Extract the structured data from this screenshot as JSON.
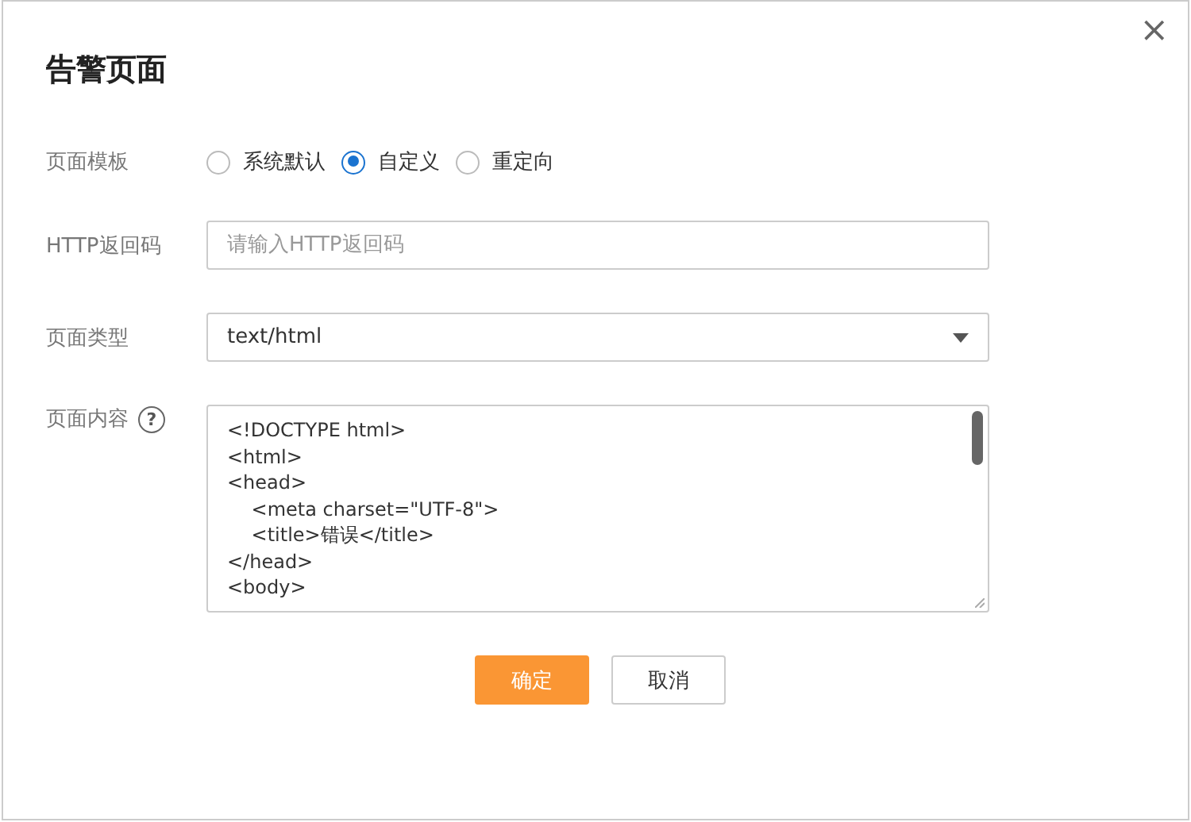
{
  "dialog": {
    "title": "告警页面",
    "close": "×"
  },
  "template": {
    "label": "页面模板",
    "options": [
      {
        "label": "系统默认",
        "selected": false
      },
      {
        "label": "自定义",
        "selected": true
      },
      {
        "label": "重定向",
        "selected": false
      }
    ]
  },
  "http_code": {
    "label": "HTTP返回码",
    "placeholder": "请输入HTTP返回码"
  },
  "page_type": {
    "label": "页面类型",
    "value": "text/html"
  },
  "page_content": {
    "label": "页面内容",
    "help": "?",
    "value": "<!DOCTYPE html>\n<html>\n<head>\n\t<meta charset=\"UTF-8\">\n\t<title>错误</title>\n</head>\n<body>"
  },
  "buttons": [
    {
      "label": "确定",
      "kind": "primary"
    },
    {
      "label": "取消",
      "kind": "secondary"
    }
  ]
}
